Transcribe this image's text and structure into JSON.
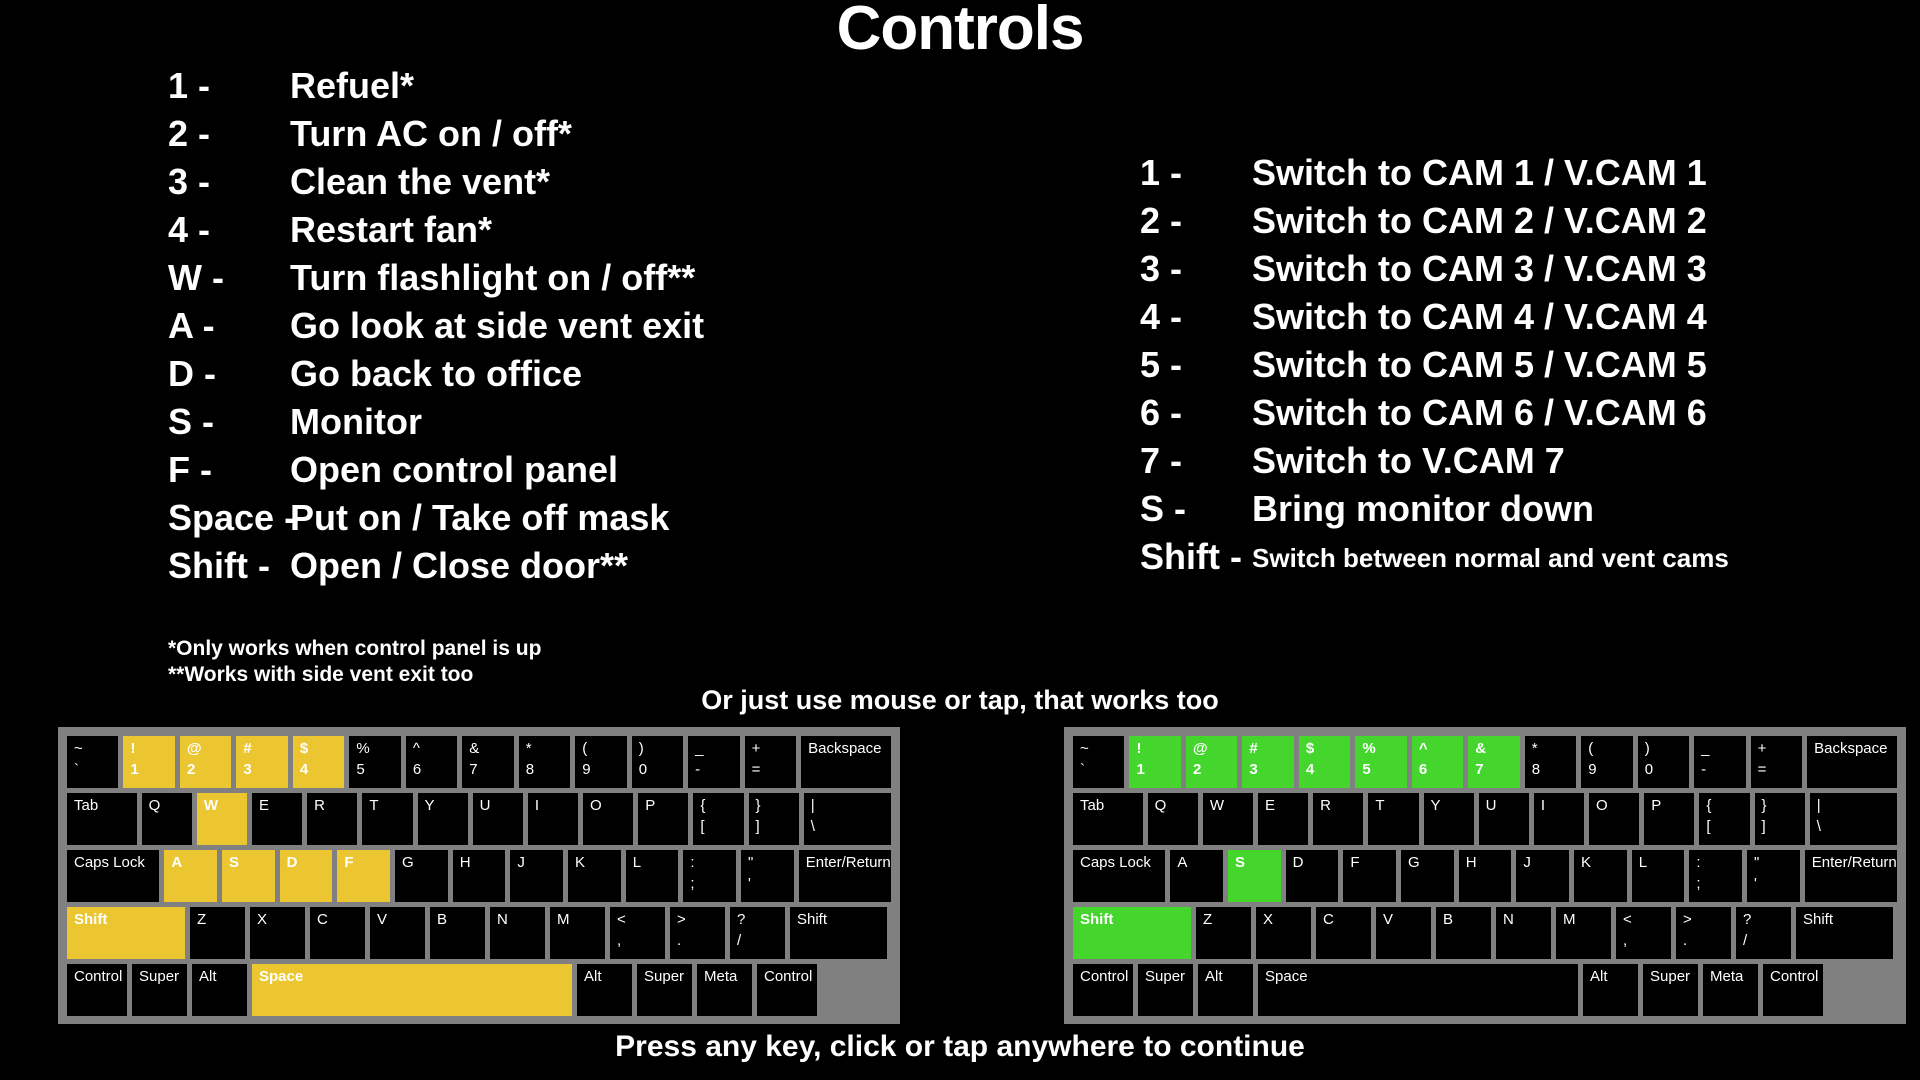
{
  "title": "Controls",
  "colors": {
    "background": "#000000",
    "text": "#ffffff",
    "keyboard_frame": "#808080",
    "key": "#000000",
    "highlight_yellow": "#ecc631",
    "highlight_green": "#44d62c"
  },
  "left_controls": [
    {
      "key": "1 -",
      "desc": "Refuel*"
    },
    {
      "key": "2 -",
      "desc": "Turn AC on / off*"
    },
    {
      "key": "3 -",
      "desc": "Clean the vent*"
    },
    {
      "key": "4 -",
      "desc": "Restart fan*"
    },
    {
      "key": "W -",
      "desc": "Turn flashlight on / off**"
    },
    {
      "key": "A -",
      "desc": "Go look at side vent exit"
    },
    {
      "key": "D -",
      "desc": "Go back to office"
    },
    {
      "key": "S -",
      "desc": "Monitor"
    },
    {
      "key": "F -",
      "desc": "Open control panel"
    },
    {
      "key": "Space -",
      "desc": "Put on / Take off mask"
    },
    {
      "key": "Shift -",
      "desc": "Open / Close door**"
    }
  ],
  "right_controls": [
    {
      "key": "1 -",
      "desc": "Switch to CAM 1 / V.CAM 1",
      "small": false
    },
    {
      "key": "2 -",
      "desc": "Switch to CAM 2 / V.CAM 2",
      "small": false
    },
    {
      "key": "3 -",
      "desc": "Switch to CAM 3 / V.CAM 3",
      "small": false
    },
    {
      "key": "4 -",
      "desc": "Switch to CAM 4 / V.CAM 4",
      "small": false
    },
    {
      "key": "5 -",
      "desc": "Switch to CAM 5 / V.CAM 5",
      "small": false
    },
    {
      "key": "6 -",
      "desc": "Switch to CAM 6 / V.CAM 6",
      "small": false
    },
    {
      "key": "7 -",
      "desc": "Switch to V.CAM 7",
      "small": false
    },
    {
      "key": "S -",
      "desc": "Bring monitor down",
      "small": false
    },
    {
      "key": "Shift -",
      "desc": "Switch between normal and vent cams",
      "small": true
    }
  ],
  "footnotes": [
    "*Only works when control panel is up",
    "**Works with side vent exit too"
  ],
  "mouse_note": "Or just use mouse or tap, that works too",
  "bottom_note": "Press any key, click or tap anywhere to continue",
  "keyboard_left": {
    "highlight_color": "#ecc631",
    "highlighted_keys": [
      "1",
      "2",
      "3",
      "4",
      "W",
      "A",
      "S",
      "D",
      "F",
      "Shift",
      "Space"
    ],
    "rows": [
      [
        {
          "top": "~",
          "bottom": "`",
          "w": "w1",
          "hl": ""
        },
        {
          "top": "!",
          "bottom": "1",
          "w": "w1",
          "hl": "y"
        },
        {
          "top": "@",
          "bottom": "2",
          "w": "w1",
          "hl": "y"
        },
        {
          "top": "#",
          "bottom": "3",
          "w": "w1",
          "hl": "y"
        },
        {
          "top": "$",
          "bottom": "4",
          "w": "w1",
          "hl": "y"
        },
        {
          "top": "%",
          "bottom": "5",
          "w": "w1",
          "hl": ""
        },
        {
          "top": "^",
          "bottom": "6",
          "w": "w1",
          "hl": ""
        },
        {
          "top": "&",
          "bottom": "7",
          "w": "w1",
          "hl": ""
        },
        {
          "top": "*",
          "bottom": "8",
          "w": "w1",
          "hl": ""
        },
        {
          "top": "(",
          "bottom": "9",
          "w": "w1",
          "hl": ""
        },
        {
          "top": ")",
          "bottom": "0",
          "w": "w1",
          "hl": ""
        },
        {
          "top": "_",
          "bottom": "-",
          "w": "w1",
          "hl": ""
        },
        {
          "top": "+",
          "bottom": "=",
          "w": "w1",
          "hl": ""
        },
        {
          "top": "Backspace",
          "bottom": "",
          "w": "w-back",
          "hl": ""
        }
      ],
      [
        {
          "top": "Tab",
          "bottom": "",
          "w": "w-tab",
          "hl": ""
        },
        {
          "top": "Q",
          "bottom": "",
          "w": "w1",
          "hl": ""
        },
        {
          "top": "W",
          "bottom": "",
          "w": "w1",
          "hl": "y"
        },
        {
          "top": "E",
          "bottom": "",
          "w": "w1",
          "hl": ""
        },
        {
          "top": "R",
          "bottom": "",
          "w": "w1",
          "hl": ""
        },
        {
          "top": "T",
          "bottom": "",
          "w": "w1",
          "hl": ""
        },
        {
          "top": "Y",
          "bottom": "",
          "w": "w1",
          "hl": ""
        },
        {
          "top": "U",
          "bottom": "",
          "w": "w1",
          "hl": ""
        },
        {
          "top": "I",
          "bottom": "",
          "w": "w1",
          "hl": ""
        },
        {
          "top": "O",
          "bottom": "",
          "w": "w1",
          "hl": ""
        },
        {
          "top": "P",
          "bottom": "",
          "w": "w1",
          "hl": ""
        },
        {
          "top": "{",
          "bottom": "[",
          "w": "w1",
          "hl": ""
        },
        {
          "top": "}",
          "bottom": "]",
          "w": "w1",
          "hl": ""
        },
        {
          "top": "|",
          "bottom": "\\",
          "w": "w-enter",
          "hl": ""
        }
      ],
      [
        {
          "top": "Caps Lock",
          "bottom": "",
          "w": "w-caps",
          "hl": ""
        },
        {
          "top": "A",
          "bottom": "",
          "w": "w1",
          "hl": "y"
        },
        {
          "top": "S",
          "bottom": "",
          "w": "w1",
          "hl": "y"
        },
        {
          "top": "D",
          "bottom": "",
          "w": "w1",
          "hl": "y"
        },
        {
          "top": "F",
          "bottom": "",
          "w": "w1",
          "hl": "y"
        },
        {
          "top": "G",
          "bottom": "",
          "w": "w1",
          "hl": ""
        },
        {
          "top": "H",
          "bottom": "",
          "w": "w1",
          "hl": ""
        },
        {
          "top": "J",
          "bottom": "",
          "w": "w1",
          "hl": ""
        },
        {
          "top": "K",
          "bottom": "",
          "w": "w1",
          "hl": ""
        },
        {
          "top": "L",
          "bottom": "",
          "w": "w1",
          "hl": ""
        },
        {
          "top": ":",
          "bottom": ";",
          "w": "w1",
          "hl": ""
        },
        {
          "top": "\"",
          "bottom": "'",
          "w": "w1",
          "hl": ""
        },
        {
          "top": "Enter/Return",
          "bottom": "",
          "w": "w-enter",
          "hl": ""
        }
      ],
      [
        {
          "top": "Shift",
          "bottom": "",
          "w": "w-shift",
          "hl": "y"
        },
        {
          "top": "Z",
          "bottom": "",
          "w": "w1",
          "hl": ""
        },
        {
          "top": "X",
          "bottom": "",
          "w": "w1",
          "hl": ""
        },
        {
          "top": "C",
          "bottom": "",
          "w": "w1",
          "hl": ""
        },
        {
          "top": "V",
          "bottom": "",
          "w": "w1",
          "hl": ""
        },
        {
          "top": "B",
          "bottom": "",
          "w": "w1",
          "hl": ""
        },
        {
          "top": "N",
          "bottom": "",
          "w": "w1",
          "hl": ""
        },
        {
          "top": "M",
          "bottom": "",
          "w": "w1",
          "hl": ""
        },
        {
          "top": "<",
          "bottom": ",",
          "w": "w1",
          "hl": ""
        },
        {
          "top": ">",
          "bottom": ".",
          "w": "w1",
          "hl": ""
        },
        {
          "top": "?",
          "bottom": "/",
          "w": "w1",
          "hl": ""
        },
        {
          "top": "Shift",
          "bottom": "",
          "w": "w-rshift",
          "hl": ""
        }
      ],
      [
        {
          "top": "Control",
          "bottom": "",
          "w": "w-ctl",
          "hl": ""
        },
        {
          "top": "Super",
          "bottom": "",
          "w": "w-mod",
          "hl": ""
        },
        {
          "top": "Alt",
          "bottom": "",
          "w": "w-mod",
          "hl": ""
        },
        {
          "top": "Space",
          "bottom": "",
          "w": "w-space",
          "hl": "y"
        },
        {
          "top": "Alt",
          "bottom": "",
          "w": "w-mod",
          "hl": ""
        },
        {
          "top": "Super",
          "bottom": "",
          "w": "w-mod",
          "hl": ""
        },
        {
          "top": "Meta",
          "bottom": "",
          "w": "w-mod",
          "hl": ""
        },
        {
          "top": "Control",
          "bottom": "",
          "w": "w-ctl",
          "hl": ""
        }
      ]
    ]
  },
  "keyboard_right": {
    "highlight_color": "#44d62c",
    "highlighted_keys": [
      "1",
      "2",
      "3",
      "4",
      "5",
      "6",
      "7",
      "S",
      "Shift"
    ],
    "rows": [
      [
        {
          "top": "~",
          "bottom": "`",
          "w": "w1",
          "hl": ""
        },
        {
          "top": "!",
          "bottom": "1",
          "w": "w1",
          "hl": "g"
        },
        {
          "top": "@",
          "bottom": "2",
          "w": "w1",
          "hl": "g"
        },
        {
          "top": "#",
          "bottom": "3",
          "w": "w1",
          "hl": "g"
        },
        {
          "top": "$",
          "bottom": "4",
          "w": "w1",
          "hl": "g"
        },
        {
          "top": "%",
          "bottom": "5",
          "w": "w1",
          "hl": "g"
        },
        {
          "top": "^",
          "bottom": "6",
          "w": "w1",
          "hl": "g"
        },
        {
          "top": "&",
          "bottom": "7",
          "w": "w1",
          "hl": "g"
        },
        {
          "top": "*",
          "bottom": "8",
          "w": "w1",
          "hl": ""
        },
        {
          "top": "(",
          "bottom": "9",
          "w": "w1",
          "hl": ""
        },
        {
          "top": ")",
          "bottom": "0",
          "w": "w1",
          "hl": ""
        },
        {
          "top": "_",
          "bottom": "-",
          "w": "w1",
          "hl": ""
        },
        {
          "top": "+",
          "bottom": "=",
          "w": "w1",
          "hl": ""
        },
        {
          "top": "Backspace",
          "bottom": "",
          "w": "w-back",
          "hl": ""
        }
      ],
      [
        {
          "top": "Tab",
          "bottom": "",
          "w": "w-tab",
          "hl": ""
        },
        {
          "top": "Q",
          "bottom": "",
          "w": "w1",
          "hl": ""
        },
        {
          "top": "W",
          "bottom": "",
          "w": "w1",
          "hl": ""
        },
        {
          "top": "E",
          "bottom": "",
          "w": "w1",
          "hl": ""
        },
        {
          "top": "R",
          "bottom": "",
          "w": "w1",
          "hl": ""
        },
        {
          "top": "T",
          "bottom": "",
          "w": "w1",
          "hl": ""
        },
        {
          "top": "Y",
          "bottom": "",
          "w": "w1",
          "hl": ""
        },
        {
          "top": "U",
          "bottom": "",
          "w": "w1",
          "hl": ""
        },
        {
          "top": "I",
          "bottom": "",
          "w": "w1",
          "hl": ""
        },
        {
          "top": "O",
          "bottom": "",
          "w": "w1",
          "hl": ""
        },
        {
          "top": "P",
          "bottom": "",
          "w": "w1",
          "hl": ""
        },
        {
          "top": "{",
          "bottom": "[",
          "w": "w1",
          "hl": ""
        },
        {
          "top": "}",
          "bottom": "]",
          "w": "w1",
          "hl": ""
        },
        {
          "top": "|",
          "bottom": "\\",
          "w": "w-enter",
          "hl": ""
        }
      ],
      [
        {
          "top": "Caps Lock",
          "bottom": "",
          "w": "w-caps",
          "hl": ""
        },
        {
          "top": "A",
          "bottom": "",
          "w": "w1",
          "hl": ""
        },
        {
          "top": "S",
          "bottom": "",
          "w": "w1",
          "hl": "g"
        },
        {
          "top": "D",
          "bottom": "",
          "w": "w1",
          "hl": ""
        },
        {
          "top": "F",
          "bottom": "",
          "w": "w1",
          "hl": ""
        },
        {
          "top": "G",
          "bottom": "",
          "w": "w1",
          "hl": ""
        },
        {
          "top": "H",
          "bottom": "",
          "w": "w1",
          "hl": ""
        },
        {
          "top": "J",
          "bottom": "",
          "w": "w1",
          "hl": ""
        },
        {
          "top": "K",
          "bottom": "",
          "w": "w1",
          "hl": ""
        },
        {
          "top": "L",
          "bottom": "",
          "w": "w1",
          "hl": ""
        },
        {
          "top": ":",
          "bottom": ";",
          "w": "w1",
          "hl": ""
        },
        {
          "top": "\"",
          "bottom": "'",
          "w": "w1",
          "hl": ""
        },
        {
          "top": "Enter/Return",
          "bottom": "",
          "w": "w-enter",
          "hl": ""
        }
      ],
      [
        {
          "top": "Shift",
          "bottom": "",
          "w": "w-shift",
          "hl": "g"
        },
        {
          "top": "Z",
          "bottom": "",
          "w": "w1",
          "hl": ""
        },
        {
          "top": "X",
          "bottom": "",
          "w": "w1",
          "hl": ""
        },
        {
          "top": "C",
          "bottom": "",
          "w": "w1",
          "hl": ""
        },
        {
          "top": "V",
          "bottom": "",
          "w": "w1",
          "hl": ""
        },
        {
          "top": "B",
          "bottom": "",
          "w": "w1",
          "hl": ""
        },
        {
          "top": "N",
          "bottom": "",
          "w": "w1",
          "hl": ""
        },
        {
          "top": "M",
          "bottom": "",
          "w": "w1",
          "hl": ""
        },
        {
          "top": "<",
          "bottom": ",",
          "w": "w1",
          "hl": ""
        },
        {
          "top": ">",
          "bottom": ".",
          "w": "w1",
          "hl": ""
        },
        {
          "top": "?",
          "bottom": "/",
          "w": "w1",
          "hl": ""
        },
        {
          "top": "Shift",
          "bottom": "",
          "w": "w-rshift",
          "hl": ""
        }
      ],
      [
        {
          "top": "Control",
          "bottom": "",
          "w": "w-ctl",
          "hl": ""
        },
        {
          "top": "Super",
          "bottom": "",
          "w": "w-mod",
          "hl": ""
        },
        {
          "top": "Alt",
          "bottom": "",
          "w": "w-mod",
          "hl": ""
        },
        {
          "top": "Space",
          "bottom": "",
          "w": "w-space",
          "hl": ""
        },
        {
          "top": "Alt",
          "bottom": "",
          "w": "w-mod",
          "hl": ""
        },
        {
          "top": "Super",
          "bottom": "",
          "w": "w-mod",
          "hl": ""
        },
        {
          "top": "Meta",
          "bottom": "",
          "w": "w-mod",
          "hl": ""
        },
        {
          "top": "Control",
          "bottom": "",
          "w": "w-ctl",
          "hl": ""
        }
      ]
    ]
  }
}
